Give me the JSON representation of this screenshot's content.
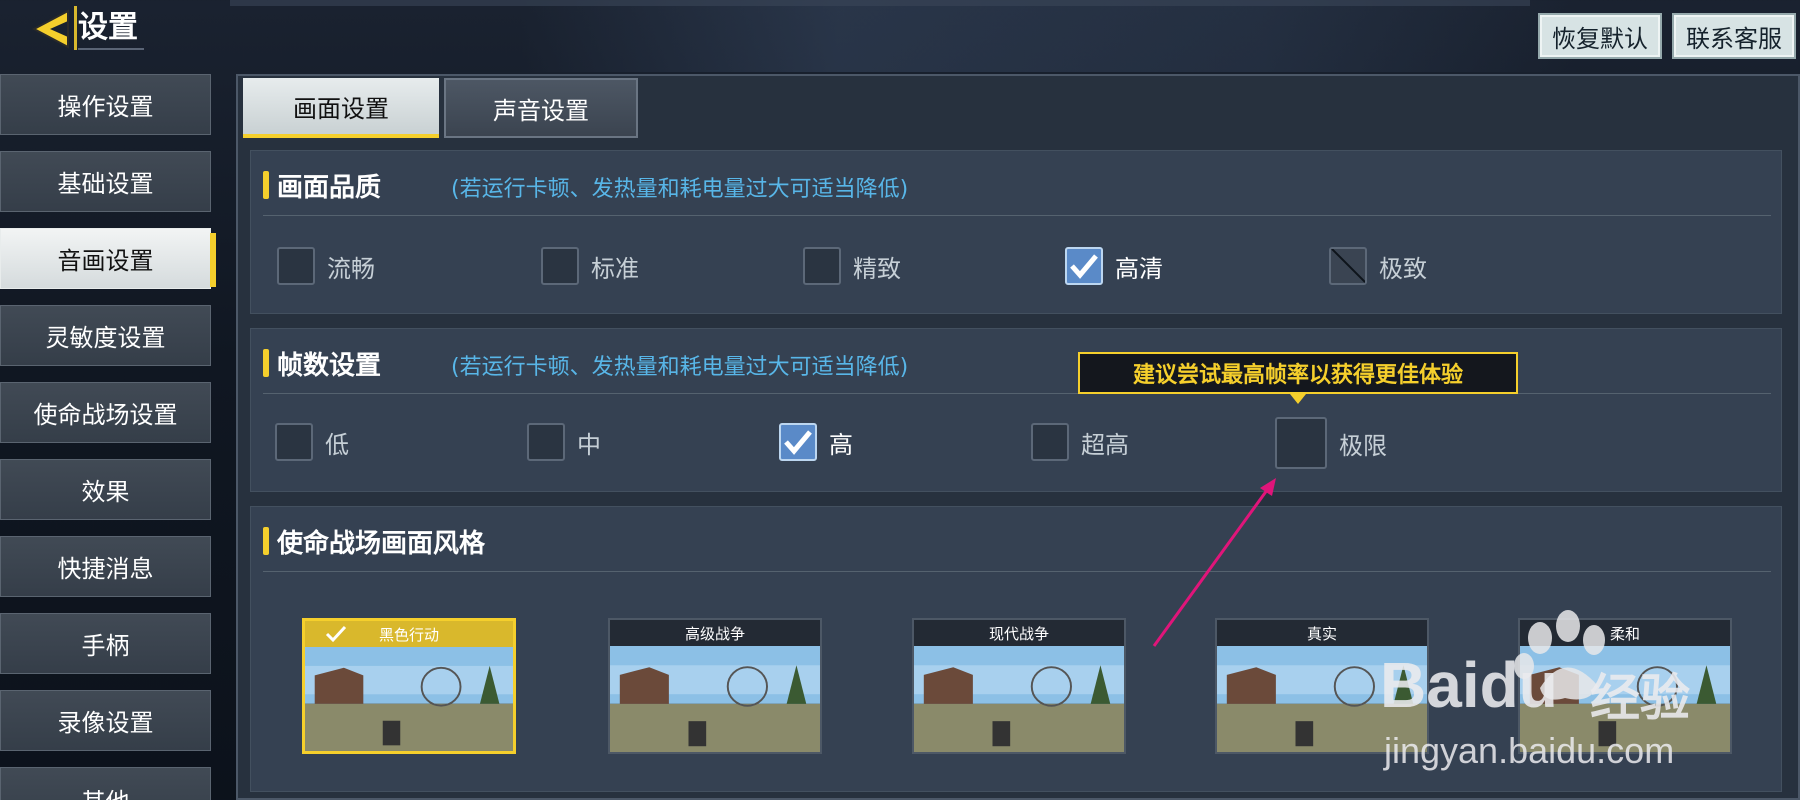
{
  "header": {
    "title": "设置",
    "restore_default": "恢复默认",
    "contact_support": "联系客服"
  },
  "sidebar": {
    "items": [
      {
        "label": "操作设置"
      },
      {
        "label": "基础设置"
      },
      {
        "label": "音画设置",
        "active": true
      },
      {
        "label": "灵敏度设置"
      },
      {
        "label": "使命战场设置"
      },
      {
        "label": "效果"
      },
      {
        "label": "快捷消息"
      },
      {
        "label": "手柄"
      },
      {
        "label": "录像设置"
      },
      {
        "label": "其他"
      }
    ]
  },
  "tabs": [
    {
      "label": "画面设置",
      "active": true
    },
    {
      "label": "声音设置"
    }
  ],
  "quality": {
    "title": "画面品质",
    "hint": "(若运行卡顿、发热量和耗电量过大可适当降低)",
    "options": [
      {
        "label": "流畅",
        "checked": false
      },
      {
        "label": "标准",
        "checked": false
      },
      {
        "label": "精致",
        "checked": false
      },
      {
        "label": "高清",
        "checked": true
      },
      {
        "label": "极致",
        "checked": false,
        "disabled": true
      }
    ]
  },
  "framerate": {
    "title": "帧数设置",
    "hint": "(若运行卡顿、发热量和耗电量过大可适当降低)",
    "tooltip": "建议尝试最高帧率以获得更佳体验",
    "options": [
      {
        "label": "低",
        "checked": false
      },
      {
        "label": "中",
        "checked": false
      },
      {
        "label": "高",
        "checked": true
      },
      {
        "label": "超高",
        "checked": false
      },
      {
        "label": "极限",
        "checked": false
      }
    ]
  },
  "style": {
    "title": "使命战场画面风格",
    "options": [
      {
        "label": "黑色行动",
        "selected": true
      },
      {
        "label": "高级战争"
      },
      {
        "label": "现代战争"
      },
      {
        "label": "真实"
      },
      {
        "label": "柔和"
      }
    ]
  },
  "watermark": {
    "brand": "Baidu",
    "service": "经验",
    "url": "jingyan.baidu.com"
  },
  "colors": {
    "accent": "#f5cf2c",
    "hint": "#58b6e8",
    "panel": "#27313e",
    "checked": "#5a8ac8",
    "annotation_arrow": "#e0157a"
  }
}
